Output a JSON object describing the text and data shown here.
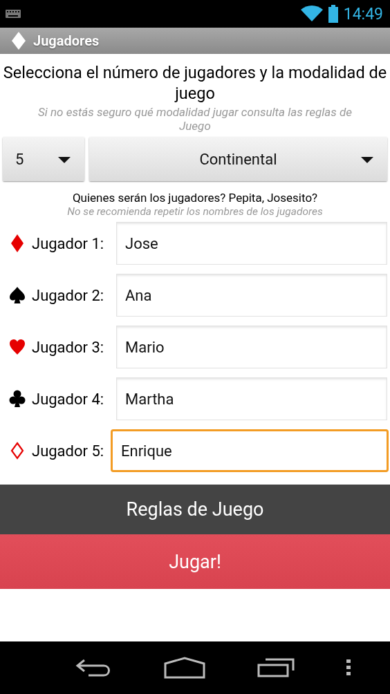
{
  "status_bar": {
    "time": "14:49"
  },
  "action_bar": {
    "title": "Jugadores"
  },
  "instructions": {
    "heading": "Selecciona el número de jugadores y la modalidad de juego",
    "hint": "Si no estás seguro qué modalidad jugar consulta las reglas de Juego"
  },
  "spinners": [
    {
      "value": "5"
    },
    {
      "value": "Continental"
    }
  ],
  "prompt": {
    "question": "Quienes serán los jugadores? Pepita, Josesito?",
    "hint": "No se recomienda repetir los nombres de los jugadores"
  },
  "players": [
    {
      "kind": "diamond",
      "label": "Jugador 1:",
      "value": "Jose",
      "focused": false
    },
    {
      "kind": "spade",
      "label": "Jugador 2:",
      "value": "Ana",
      "focused": false
    },
    {
      "kind": "heart",
      "label": "Jugador 3:",
      "value": "Mario",
      "focused": false
    },
    {
      "kind": "club",
      "label": "Jugador 4:",
      "value": "Martha",
      "focused": false
    },
    {
      "kind": "diamond-outline",
      "label": "Jugador 5:",
      "value": "Enrique",
      "focused": true
    }
  ],
  "buttons": [
    {
      "kind": "secondary",
      "label": "Reglas de Juego"
    },
    {
      "kind": "primary",
      "label": "Jugar!"
    }
  ]
}
